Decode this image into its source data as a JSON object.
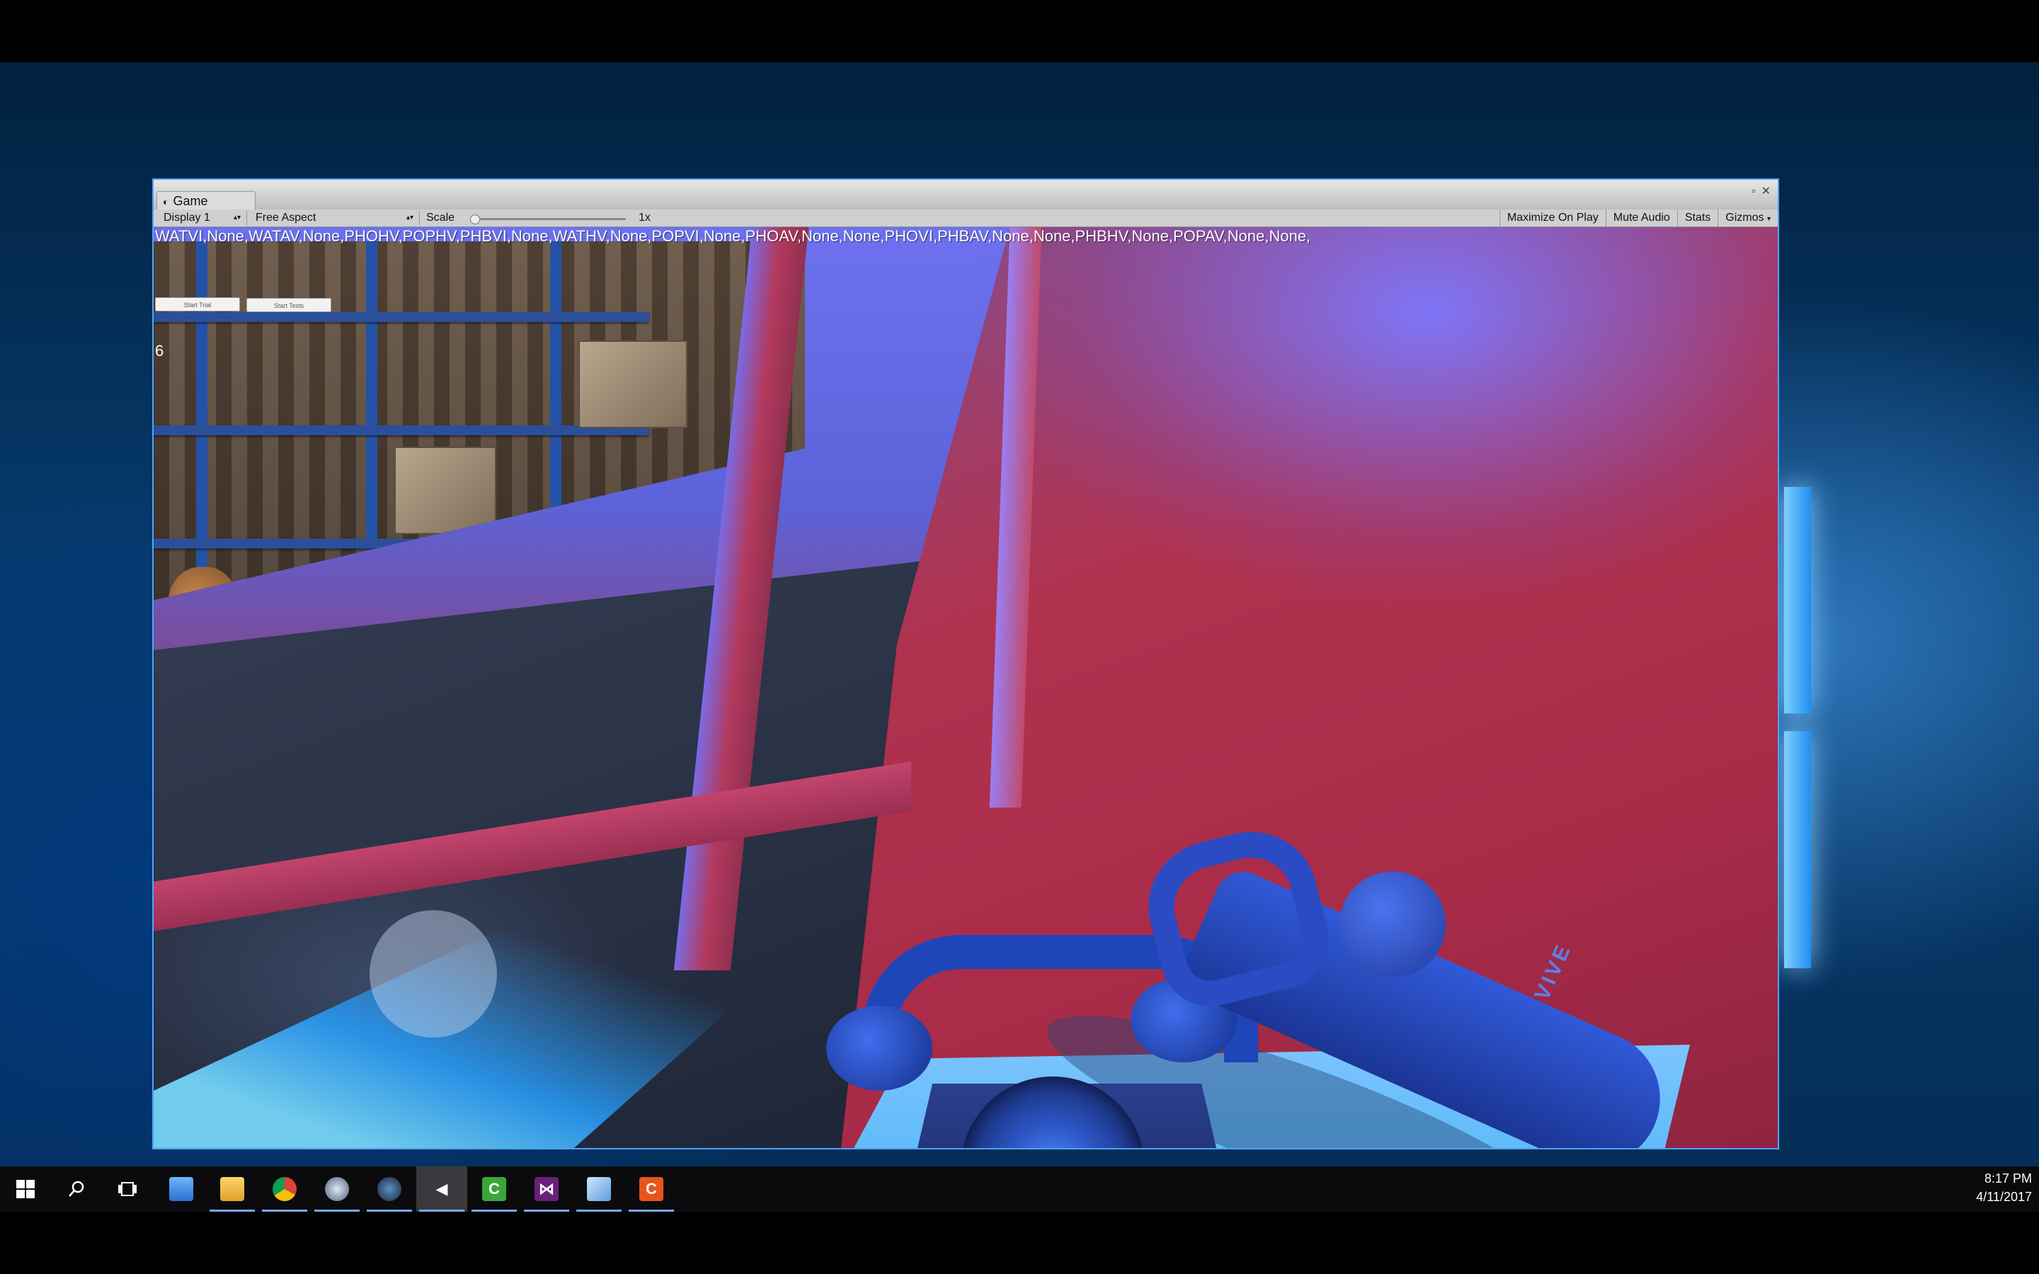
{
  "unity": {
    "tab_title": "Game",
    "display_dropdown": "Display 1",
    "aspect_dropdown": "Free Aspect",
    "scale_label": "Scale",
    "scale_value": "1x",
    "scale_fraction": 0.0,
    "toolbar_buttons": [
      "Maximize On Play",
      "Mute Audio",
      "Stats",
      "Gizmos"
    ]
  },
  "game": {
    "debug_text": "WATVI,None,WATAV,None,PHOHV,POPHV,PHBVI,None,WATHV,None,POPVI,None,PHOAV,None,None,PHOVI,PHBAV,None,None,PHBHV,None,POPAV,None,None,",
    "button_trial": "Start Trial",
    "button_tests": "Start Tests",
    "counter": "6",
    "controller_logo": "VIVE"
  },
  "taskbar": {
    "icons": [
      "windows-start-icon",
      "search-icon",
      "task-view-icon",
      "network-laptop-icon",
      "file-explorer-icon",
      "chrome-icon",
      "steamvr-icon",
      "steam-icon",
      "unity-icon",
      "camtasia-icon",
      "visual-studio-icon",
      "app-icon",
      "camtasia-recorder-icon"
    ],
    "time": "8:17 PM",
    "date": "4/11/2017"
  },
  "colors": {
    "selection_blue": "#4da3ff",
    "taskbar": "#0b0b0d",
    "booth_red": "#a82b48",
    "phone_blue": "#1f46b8"
  }
}
